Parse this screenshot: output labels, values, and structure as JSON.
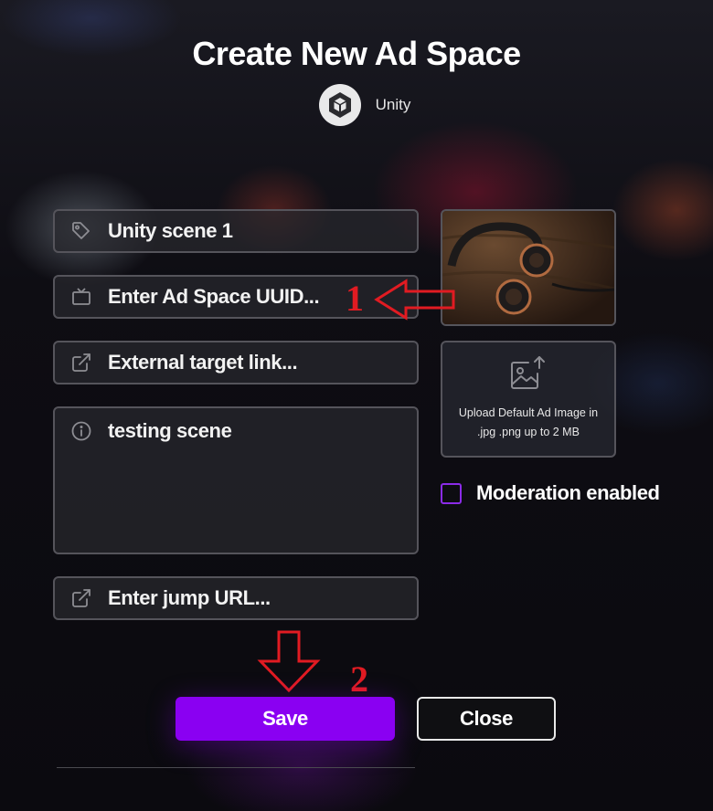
{
  "dialog": {
    "title": "Create New Ad Space",
    "engine": {
      "name": "Unity",
      "icon": "unity-logo-icon"
    }
  },
  "form": {
    "name": {
      "value": "Unity scene 1",
      "icon": "tag-icon"
    },
    "uuid": {
      "placeholder": "Enter Ad Space UUID...",
      "icon": "tv-icon"
    },
    "target_link": {
      "placeholder": "External target link...",
      "icon": "external-link-icon"
    },
    "description": {
      "value": "testing scene",
      "icon": "info-icon"
    },
    "jump_url": {
      "placeholder": "Enter jump URL...",
      "icon": "external-link-icon"
    }
  },
  "image": {
    "upload_line1": "Upload Default Ad Image in",
    "upload_line2": ".jpg .png up to 2 MB",
    "upload_icon": "image-upload-icon"
  },
  "moderation": {
    "label": "Moderation enabled",
    "checked": false
  },
  "actions": {
    "save_label": "Save",
    "close_label": "Close"
  },
  "annotations": {
    "step1": "1",
    "step2": "2"
  },
  "colors": {
    "accent": "#8a00f2",
    "annotation": "#e11b22",
    "field_border": "#55545b"
  }
}
